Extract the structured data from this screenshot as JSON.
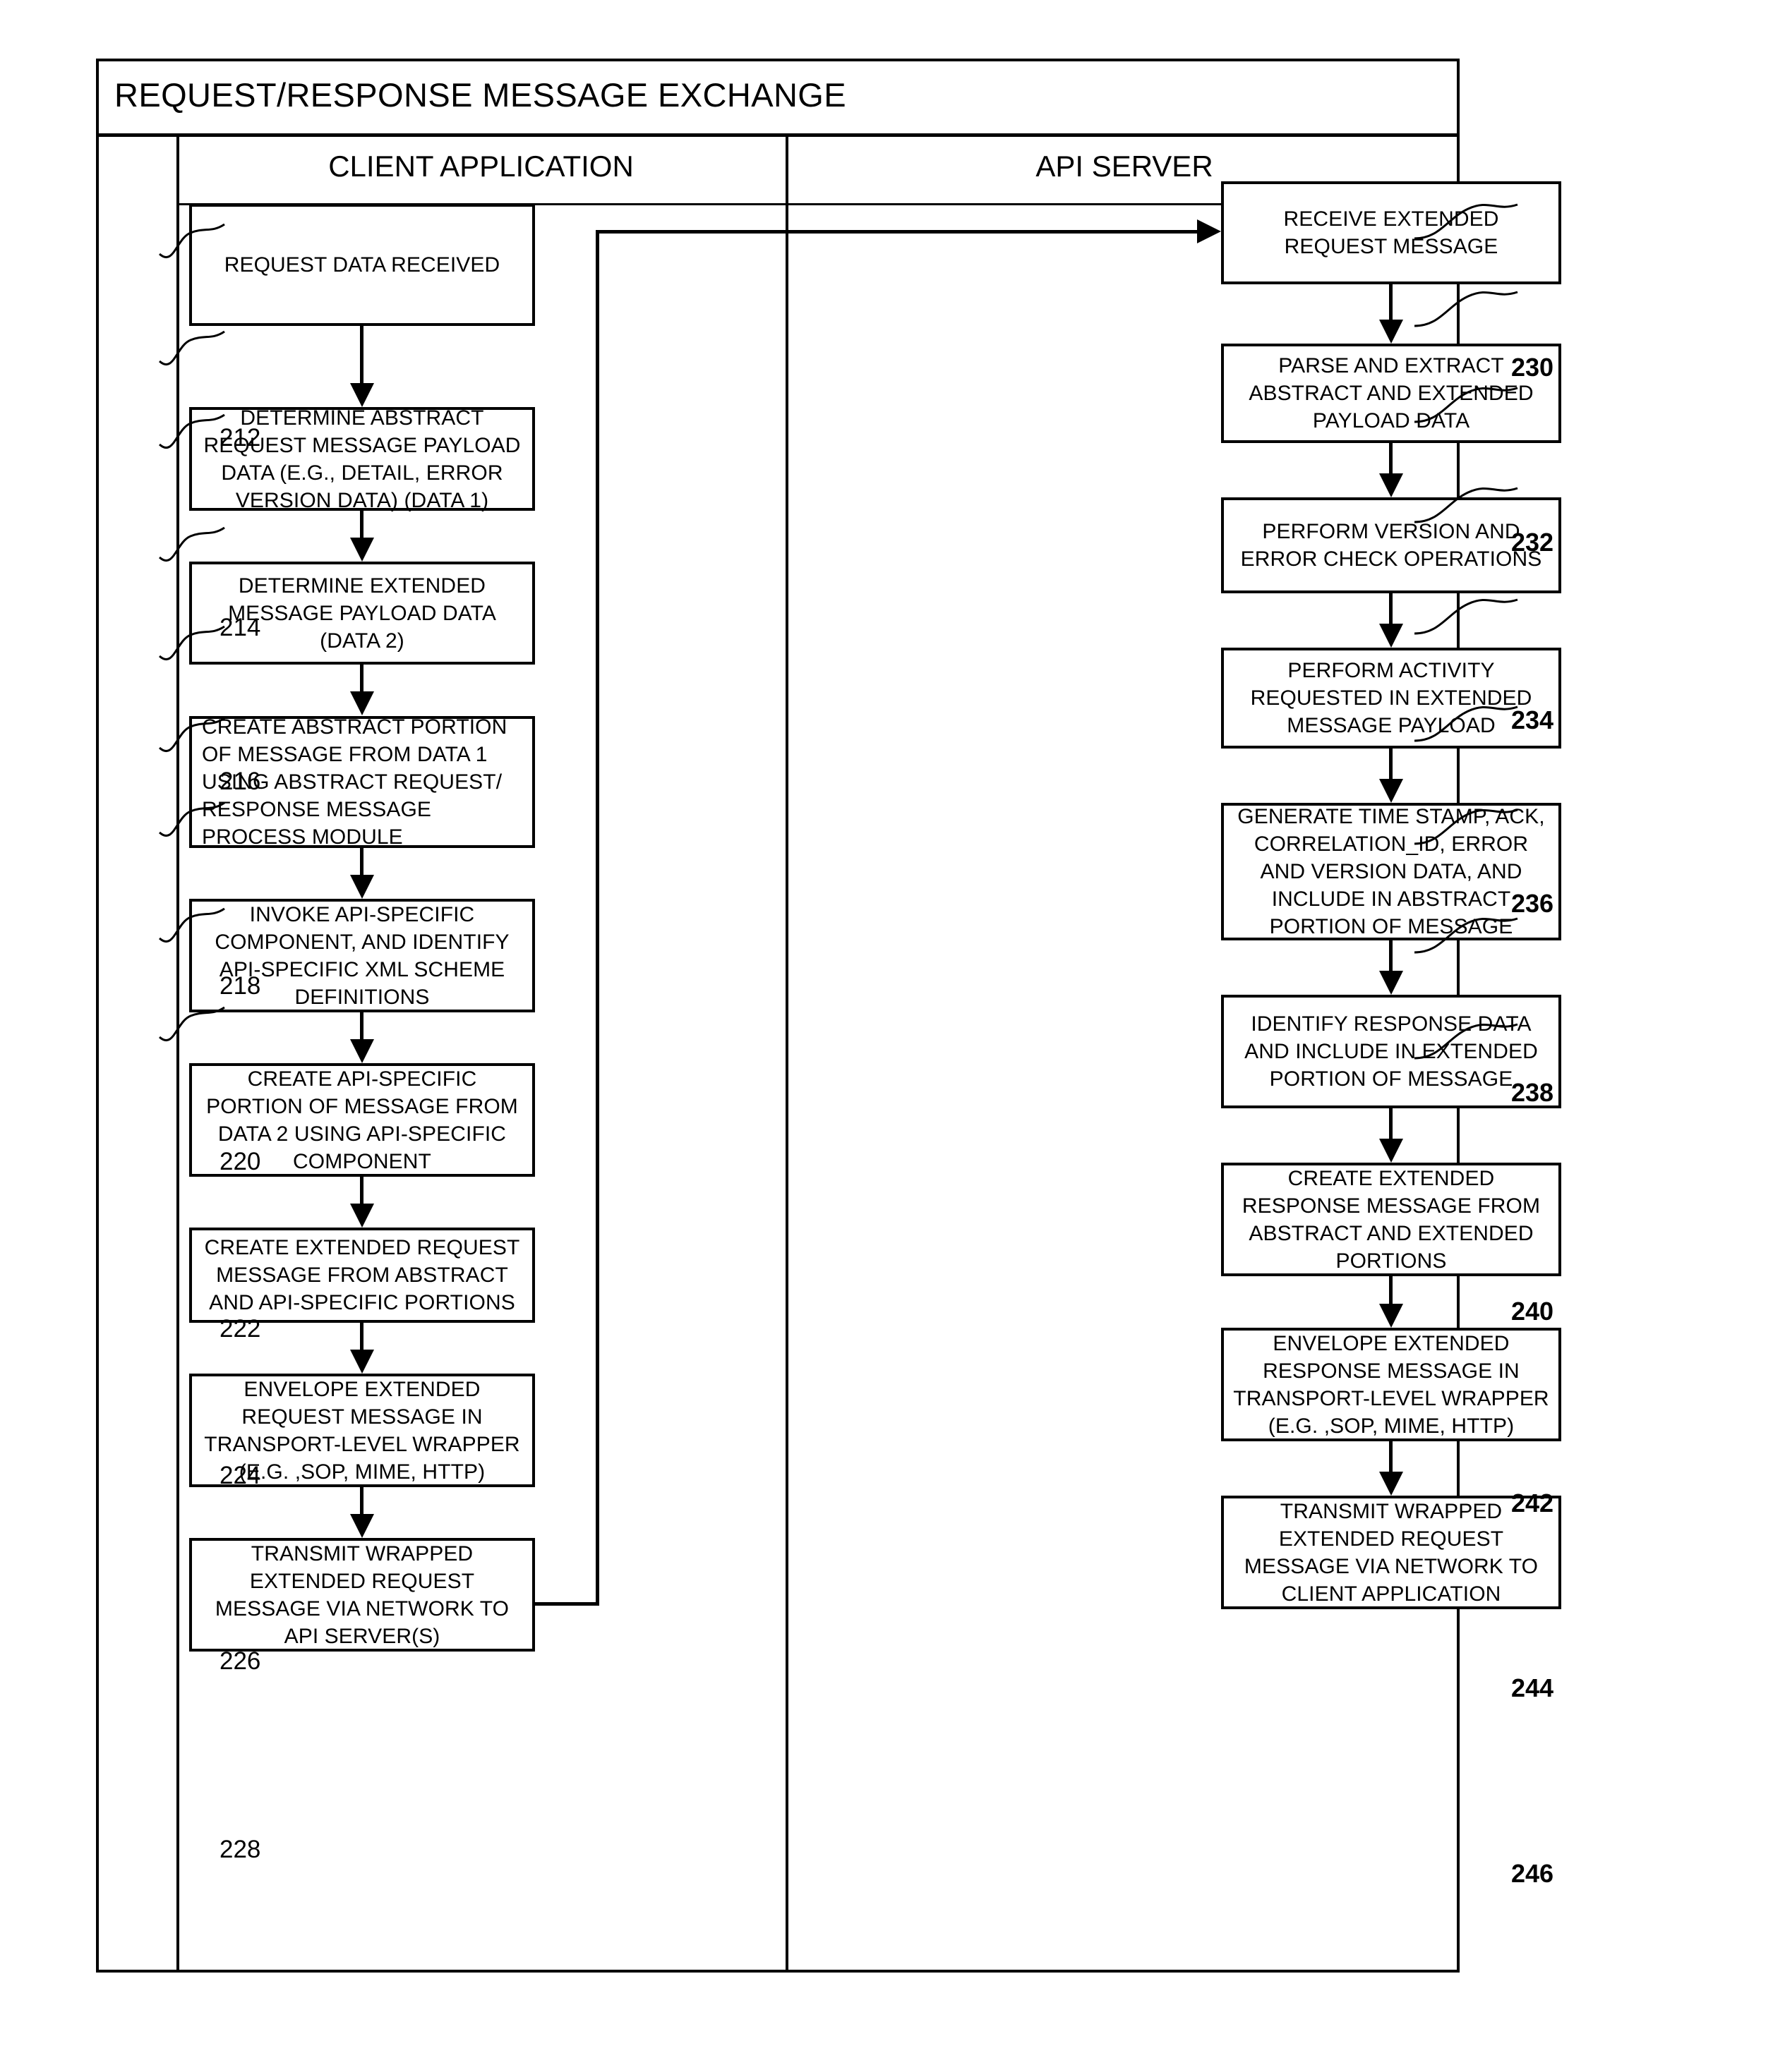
{
  "figure": {
    "title": "REQUEST/RESPONSE MESSAGE EXCHANGE"
  },
  "lanes": [
    {
      "id": "client",
      "title": "CLIENT APPLICATION"
    },
    {
      "id": "server",
      "title": "API SERVER"
    }
  ],
  "client_steps": [
    {
      "ref": "212",
      "text": "REQUEST DATA RECEIVED"
    },
    {
      "ref": "214",
      "text": "DETERMINE ABSTRACT REQUEST MESSAGE PAYLOAD DATA (E.G., DETAIL, ERROR VERSION DATA) (DATA 1)"
    },
    {
      "ref": "216",
      "text": "DETERMINE EXTENDED MESSAGE PAYLOAD DATA (DATA 2)"
    },
    {
      "ref": "218",
      "text": "CREATE ABSTRACT PORTION OF MESSAGE FROM DATA 1 USING ABSTRACT REQUEST/ RESPONSE MESSAGE PROCESS MODULE"
    },
    {
      "ref": "220",
      "text": "INVOKE API-SPECIFIC COMPONENT, AND IDENTIFY API-SPECIFIC XML SCHEME DEFINITIONS"
    },
    {
      "ref": "222",
      "text": "CREATE API-SPECIFIC PORTION OF MESSAGE FROM DATA 2 USING API-SPECIFIC COMPONENT"
    },
    {
      "ref": "224",
      "text": "CREATE EXTENDED REQUEST MESSAGE FROM ABSTRACT AND API-SPECIFIC PORTIONS"
    },
    {
      "ref": "226",
      "text": "ENVELOPE EXTENDED REQUEST MESSAGE IN TRANSPORT-LEVEL WRAPPER (E.G. ,SOP, MIME, HTTP)"
    },
    {
      "ref": "228",
      "text": "TRANSMIT WRAPPED EXTENDED REQUEST MESSAGE VIA NETWORK TO API SERVER(S)"
    }
  ],
  "server_steps": [
    {
      "ref": "230",
      "text": "RECEIVE EXTENDED REQUEST MESSAGE"
    },
    {
      "ref": "232",
      "text": "PARSE AND EXTRACT ABSTRACT AND EXTENDED PAYLOAD DATA"
    },
    {
      "ref": "234",
      "text": "PERFORM VERSION AND ERROR CHECK OPERATIONS"
    },
    {
      "ref": "236",
      "text": "PERFORM ACTIVITY REQUESTED IN EXTENDED MESSAGE PAYLOAD"
    },
    {
      "ref": "238",
      "text": "GENERATE TIME STAMP, ACK, CORRELATION_ID, ERROR AND VERSION DATA, AND INCLUDE IN ABSTRACT PORTION OF MESSAGE"
    },
    {
      "ref": "240",
      "text": "IDENTIFY RESPONSE DATA AND INCLUDE IN EXTENDED PORTION OF MESSAGE"
    },
    {
      "ref": "242",
      "text": "CREATE EXTENDED RESPONSE  MESSAGE FROM ABSTRACT AND EXTENDED PORTIONS"
    },
    {
      "ref": "244",
      "text": "ENVELOPE EXTENDED RESPONSE MESSAGE IN TRANSPORT-LEVEL WRAPPER (E.G. ,SOP, MIME, HTTP)"
    },
    {
      "ref": "246",
      "text": "TRANSMIT WRAPPED EXTENDED REQUEST MESSAGE VIA NETWORK TO CLIENT APPLICATION"
    }
  ],
  "colors": {
    "ink": "#000000",
    "paper": "#ffffff"
  }
}
